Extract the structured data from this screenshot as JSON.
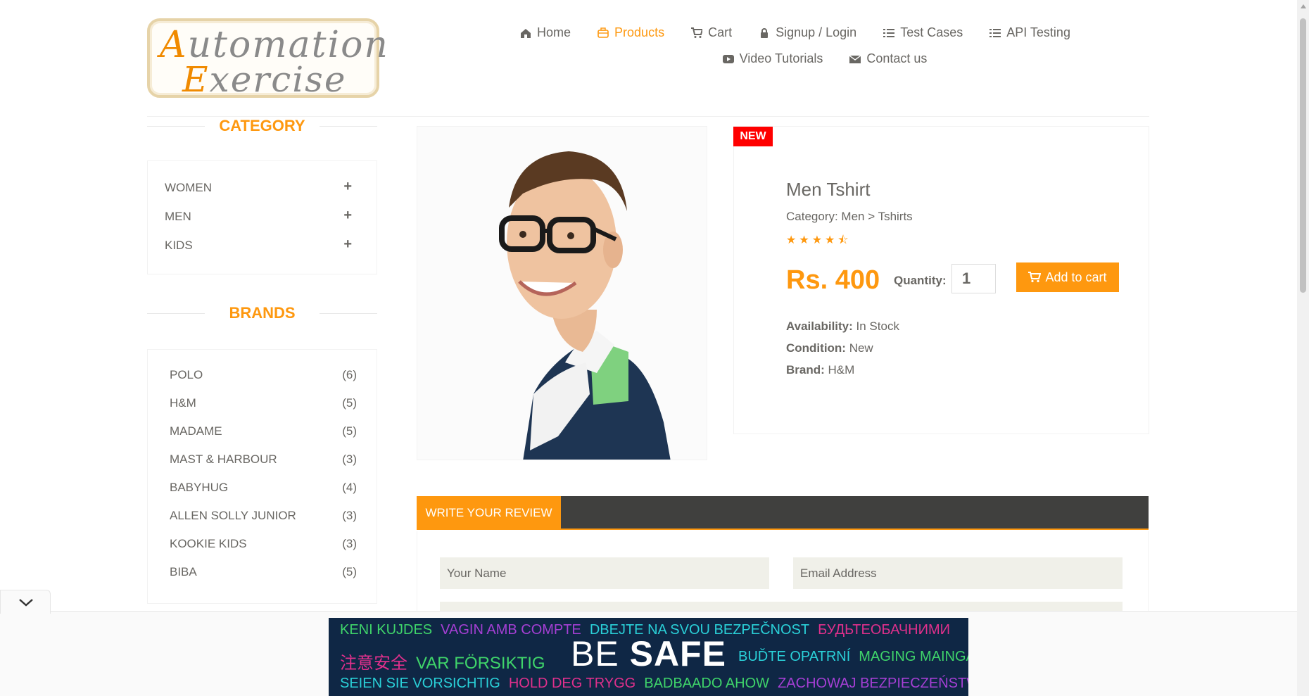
{
  "logo": {
    "line1": "Automation",
    "line2": "Exercise"
  },
  "nav": {
    "row1": [
      {
        "label": "Home",
        "icon": "home-icon"
      },
      {
        "label": "Products",
        "icon": "briefcase-icon",
        "active": true
      },
      {
        "label": "Cart",
        "icon": "cart-icon"
      },
      {
        "label": "Signup / Login",
        "icon": "lock-icon"
      },
      {
        "label": "Test Cases",
        "icon": "list-icon"
      },
      {
        "label": "API Testing",
        "icon": "list-icon"
      }
    ],
    "row2": [
      {
        "label": "Video Tutorials",
        "icon": "youtube-play-icon"
      },
      {
        "label": "Contact us",
        "icon": "envelope-icon"
      }
    ]
  },
  "sidebar": {
    "category_title": "CATEGORY",
    "categories": [
      "WOMEN",
      "MEN",
      "KIDS"
    ],
    "brands_title": "BRANDS",
    "brands": [
      {
        "name": "POLO",
        "count": "(6)"
      },
      {
        "name": "H&M",
        "count": "(5)"
      },
      {
        "name": "MADAME",
        "count": "(5)"
      },
      {
        "name": "MAST & HARBOUR",
        "count": "(3)"
      },
      {
        "name": "BABYHUG",
        "count": "(4)"
      },
      {
        "name": "ALLEN SOLLY JUNIOR",
        "count": "(3)"
      },
      {
        "name": "KOOKIE KIDS",
        "count": "(3)"
      },
      {
        "name": "BIBA",
        "count": "(5)"
      }
    ]
  },
  "product": {
    "badge": "NEW",
    "name": "Men Tshirt",
    "category": "Category: Men > Tshirts",
    "rating": 4.5,
    "price": "Rs. 400",
    "quantity_label": "Quantity:",
    "quantity_value": "1",
    "add_to_cart": "Add to cart",
    "availability_label": "Availability:",
    "availability": "In Stock",
    "condition_label": "Condition:",
    "condition": "New",
    "brand_label": "Brand:",
    "brand": "H&M"
  },
  "review": {
    "tab": "WRITE YOUR REVIEW",
    "name_placeholder": "Your Name",
    "email_placeholder": "Email Address"
  },
  "ad": {
    "line1": [
      {
        "text": "KENI KUJDES",
        "color": "#3fd46a"
      },
      {
        "text": "VAGIN AMB COMPTE",
        "color": "#a53fd4"
      },
      {
        "text": "DBEJTE NA SVOU BEZPEČNOST",
        "color": "#2ad0d8"
      },
      {
        "text": "БУДЬТЕОБАЧНИМИ",
        "color": "#e0308c"
      }
    ],
    "line2": [
      {
        "text": "注意安全",
        "color": "#e0308c"
      },
      {
        "text": "VAR FÖRSIKTIG",
        "color": "#3fd46a"
      }
    ],
    "big_light": "BE ",
    "big_bold": "SAFE",
    "line2_right": [
      {
        "text": "BUĎTE OPATRNÍ",
        "color": "#2ad0d8"
      },
      {
        "text": "MAGING MAINGAT",
        "color": "#3fd46a"
      }
    ],
    "line3": [
      {
        "text": "SEIEN SIE VORSICHTIG",
        "color": "#2ad0d8"
      },
      {
        "text": "HOLD DEG TRYGG",
        "color": "#e0308c"
      },
      {
        "text": "BADBAADO AHOW",
        "color": "#3fd46a"
      },
      {
        "text": "ZACHOWAJ BEZPIECZEŃSTWO",
        "color": "#a53fd4"
      }
    ]
  },
  "colors": {
    "accent": "#FE980F",
    "text": "#696763",
    "badge": "#ff0000",
    "review_bar": "#40403e"
  }
}
